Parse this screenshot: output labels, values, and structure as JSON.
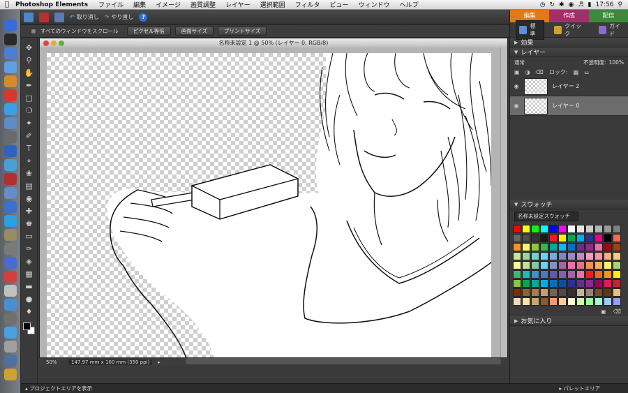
{
  "menubar": {
    "app_name": "Photoshop Elements",
    "items": [
      "ファイル",
      "編集",
      "イメージ",
      "画質調整",
      "レイヤー",
      "選択範囲",
      "フィルタ",
      "ビュー",
      "ウィンドウ",
      "ヘルプ"
    ],
    "clock": "17:56"
  },
  "toolbar": {
    "undo_label": "取り消し",
    "redo_label": "やり直し",
    "help_label": "?"
  },
  "options": {
    "scroll_all_label": "すべてのウィンドウをスクロール",
    "buttons": [
      "ピクセル等倍",
      "画面サイズ",
      "プリントサイズ"
    ]
  },
  "document": {
    "title": "名称未設定 1 @ 50% (レイヤー 0, RGB/8)",
    "zoom": "50%",
    "info": "147.97 mm x 100 mm (350 ppi)"
  },
  "panel": {
    "mode_tabs": [
      {
        "label": "編集",
        "color": "#e07a16"
      },
      {
        "label": "作成",
        "color": "#a0306a"
      },
      {
        "label": "配信",
        "color": "#3a8a3a"
      }
    ],
    "sub_tabs": [
      "標準",
      "クイック",
      "ガイド"
    ],
    "effects_title": "効果",
    "layers_title": "レイヤー",
    "blend_mode": "通常",
    "opacity_label": "不透明度:",
    "opacity_value": "100%",
    "lock_label": "ロック:",
    "layers": [
      {
        "name": "レイヤー 2",
        "selected": false
      },
      {
        "name": "レイヤー 0",
        "selected": true
      }
    ],
    "swatches_title": "スウォッチ",
    "swatch_set": "名称未設定スウォッチ",
    "favorites_title": "お気に入り",
    "swatch_colors": [
      "#ff0000",
      "#ffff00",
      "#00ff00",
      "#00ffff",
      "#0000ff",
      "#ff00ff",
      "#ffffff",
      "#e6e6e6",
      "#cccccc",
      "#b3b3b3",
      "#999999",
      "#808080",
      "#666666",
      "#4d4d4d",
      "#333333",
      "#1a1a1a",
      "#ed1c24",
      "#fff200",
      "#00a651",
      "#00aeef",
      "#2e3192",
      "#ec008c",
      "#000000",
      "#f26c4f",
      "#f7941d",
      "#fff568",
      "#8dc63f",
      "#39b54a",
      "#00a99d",
      "#00bff3",
      "#0072bc",
      "#662d91",
      "#92278f",
      "#f06eaa",
      "#9e0b0f",
      "#a0410d",
      "#c8e6a0",
      "#a3d39c",
      "#7accc8",
      "#6dcff6",
      "#7da7d9",
      "#8781bd",
      "#a186be",
      "#bd8cbf",
      "#f49ac1",
      "#f5989d",
      "#f9ad81",
      "#fdc68a",
      "#fff799",
      "#c4df9b",
      "#82ca9c",
      "#6ecff6",
      "#8393ca",
      "#a864a8",
      "#f06ea9",
      "#f26d7d",
      "#f68e56",
      "#fbaf5d",
      "#fff468",
      "#acd373",
      "#3cb878",
      "#1cbbb4",
      "#448ccb",
      "#5674b9",
      "#605ca8",
      "#855fa8",
      "#a763a8",
      "#f06eaa",
      "#ed1c24",
      "#f26522",
      "#f7941d",
      "#fff200",
      "#8dc63f",
      "#00a651",
      "#00a99d",
      "#00aeef",
      "#0072bc",
      "#0054a6",
      "#2e3192",
      "#662d91",
      "#92278f",
      "#9e005d",
      "#ed145b",
      "#c1272d",
      "#7b2e00",
      "#8c6239",
      "#a67c52",
      "#c69c6d",
      "#736357",
      "#534741",
      "#362f2d",
      "#c7b299",
      "#998675",
      "#754c24",
      "#603913",
      "#e6bf80",
      "#fbd7c0",
      "#ffe4a6",
      "#c9a66b",
      "#8b5a2b",
      "#ff9966",
      "#ffcc99",
      "#ffffcc",
      "#ccff99",
      "#99ff99",
      "#99ffcc",
      "#99ccff",
      "#9999ff"
    ]
  },
  "bottombar": {
    "project_label": "プロジェクトエリアを表示",
    "palette_label": "パレットエリア"
  },
  "dock_colors": [
    "#3b6bd6",
    "#2a2a2a",
    "#4a7fd1",
    "#60a0e0",
    "#d48a2e",
    "#d23b2b",
    "#3aa0e6",
    "#5f8bc4",
    "#6a6a6a",
    "#3060c0",
    "#4aa0d0",
    "#b03030",
    "#6a8ac8",
    "#3a70d0",
    "#2aa0e0",
    "#9a8a60",
    "#7a7a7a",
    "#4a6ad0",
    "#d04040",
    "#c0c0c0",
    "#4a90d0",
    "#707070",
    "#4aa0e0",
    "#a0a0a0",
    "#5070a0",
    "#d0a030"
  ]
}
